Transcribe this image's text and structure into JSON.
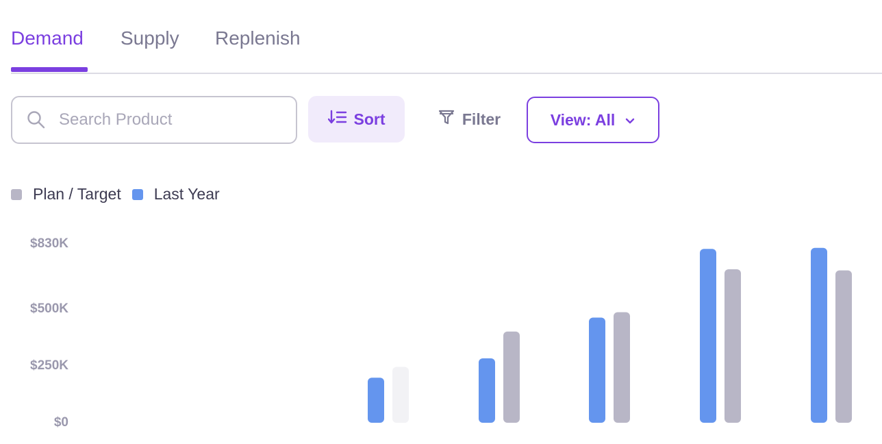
{
  "tabs": [
    {
      "label": "Demand",
      "active": true
    },
    {
      "label": "Supply",
      "active": false
    },
    {
      "label": "Replenish",
      "active": false
    }
  ],
  "toolbar": {
    "search_placeholder": "Search Product",
    "sort_label": "Sort",
    "filter_label": "Filter",
    "view_label": "View: All"
  },
  "colors": {
    "accent": "#7b3fe0",
    "last_year": "#6495ee",
    "plan_target": "#b8b6c6",
    "plan_target_faded": "#f2f2f5"
  },
  "chart_data": {
    "type": "bar",
    "legend": [
      "Plan / Target",
      "Last Year"
    ],
    "y_ticks": [
      "$830K",
      "$500K",
      "$250K",
      "$0"
    ],
    "y_tick_values": [
      830000,
      500000,
      250000,
      0
    ],
    "categories": [
      "",
      "",
      "",
      "",
      ""
    ],
    "series": [
      {
        "name": "Last Year",
        "values": [
          210000,
          300000,
          490000,
          810000,
          815000
        ]
      },
      {
        "name": "Plan / Target",
        "values": [
          260000,
          425000,
          515000,
          715000,
          710000
        ]
      }
    ]
  }
}
